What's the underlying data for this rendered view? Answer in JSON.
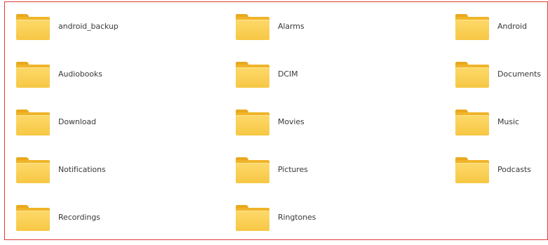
{
  "folders": [
    {
      "name": "android_backup"
    },
    {
      "name": "Alarms"
    },
    {
      "name": "Android"
    },
    {
      "name": "Audiobooks"
    },
    {
      "name": "DCIM"
    },
    {
      "name": "Documents"
    },
    {
      "name": "Download"
    },
    {
      "name": "Movies"
    },
    {
      "name": "Music"
    },
    {
      "name": "Notifications"
    },
    {
      "name": "Pictures"
    },
    {
      "name": "Podcasts"
    },
    {
      "name": "Recordings"
    },
    {
      "name": "Ringtones"
    }
  ],
  "icon": "folder-icon",
  "colors": {
    "highlight_border": "#e53935",
    "folder": "#f7c744"
  }
}
